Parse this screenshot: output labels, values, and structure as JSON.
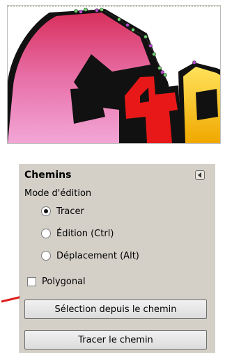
{
  "panel": {
    "title": "Chemins",
    "mode_label": "Mode d'édition",
    "modes": [
      {
        "label": "Tracer",
        "checked": true
      },
      {
        "label": "Édition (Ctrl)",
        "checked": false
      },
      {
        "label": "Déplacement (Alt)",
        "checked": false
      }
    ],
    "polygonal_label": "Polygonal",
    "polygonal_checked": false,
    "selection_button": "Sélection depuis le chemin",
    "stroke_button": "Tracer le chemin"
  },
  "colors": {
    "panel_bg": "#d4d0c8",
    "arrow": "#e02020",
    "letter_pink": "#e8589a",
    "letter_red": "#e81818",
    "letter_yellow": "#f5c400"
  },
  "icons": [
    "collapse-icon",
    "annotation-arrow-icon"
  ]
}
